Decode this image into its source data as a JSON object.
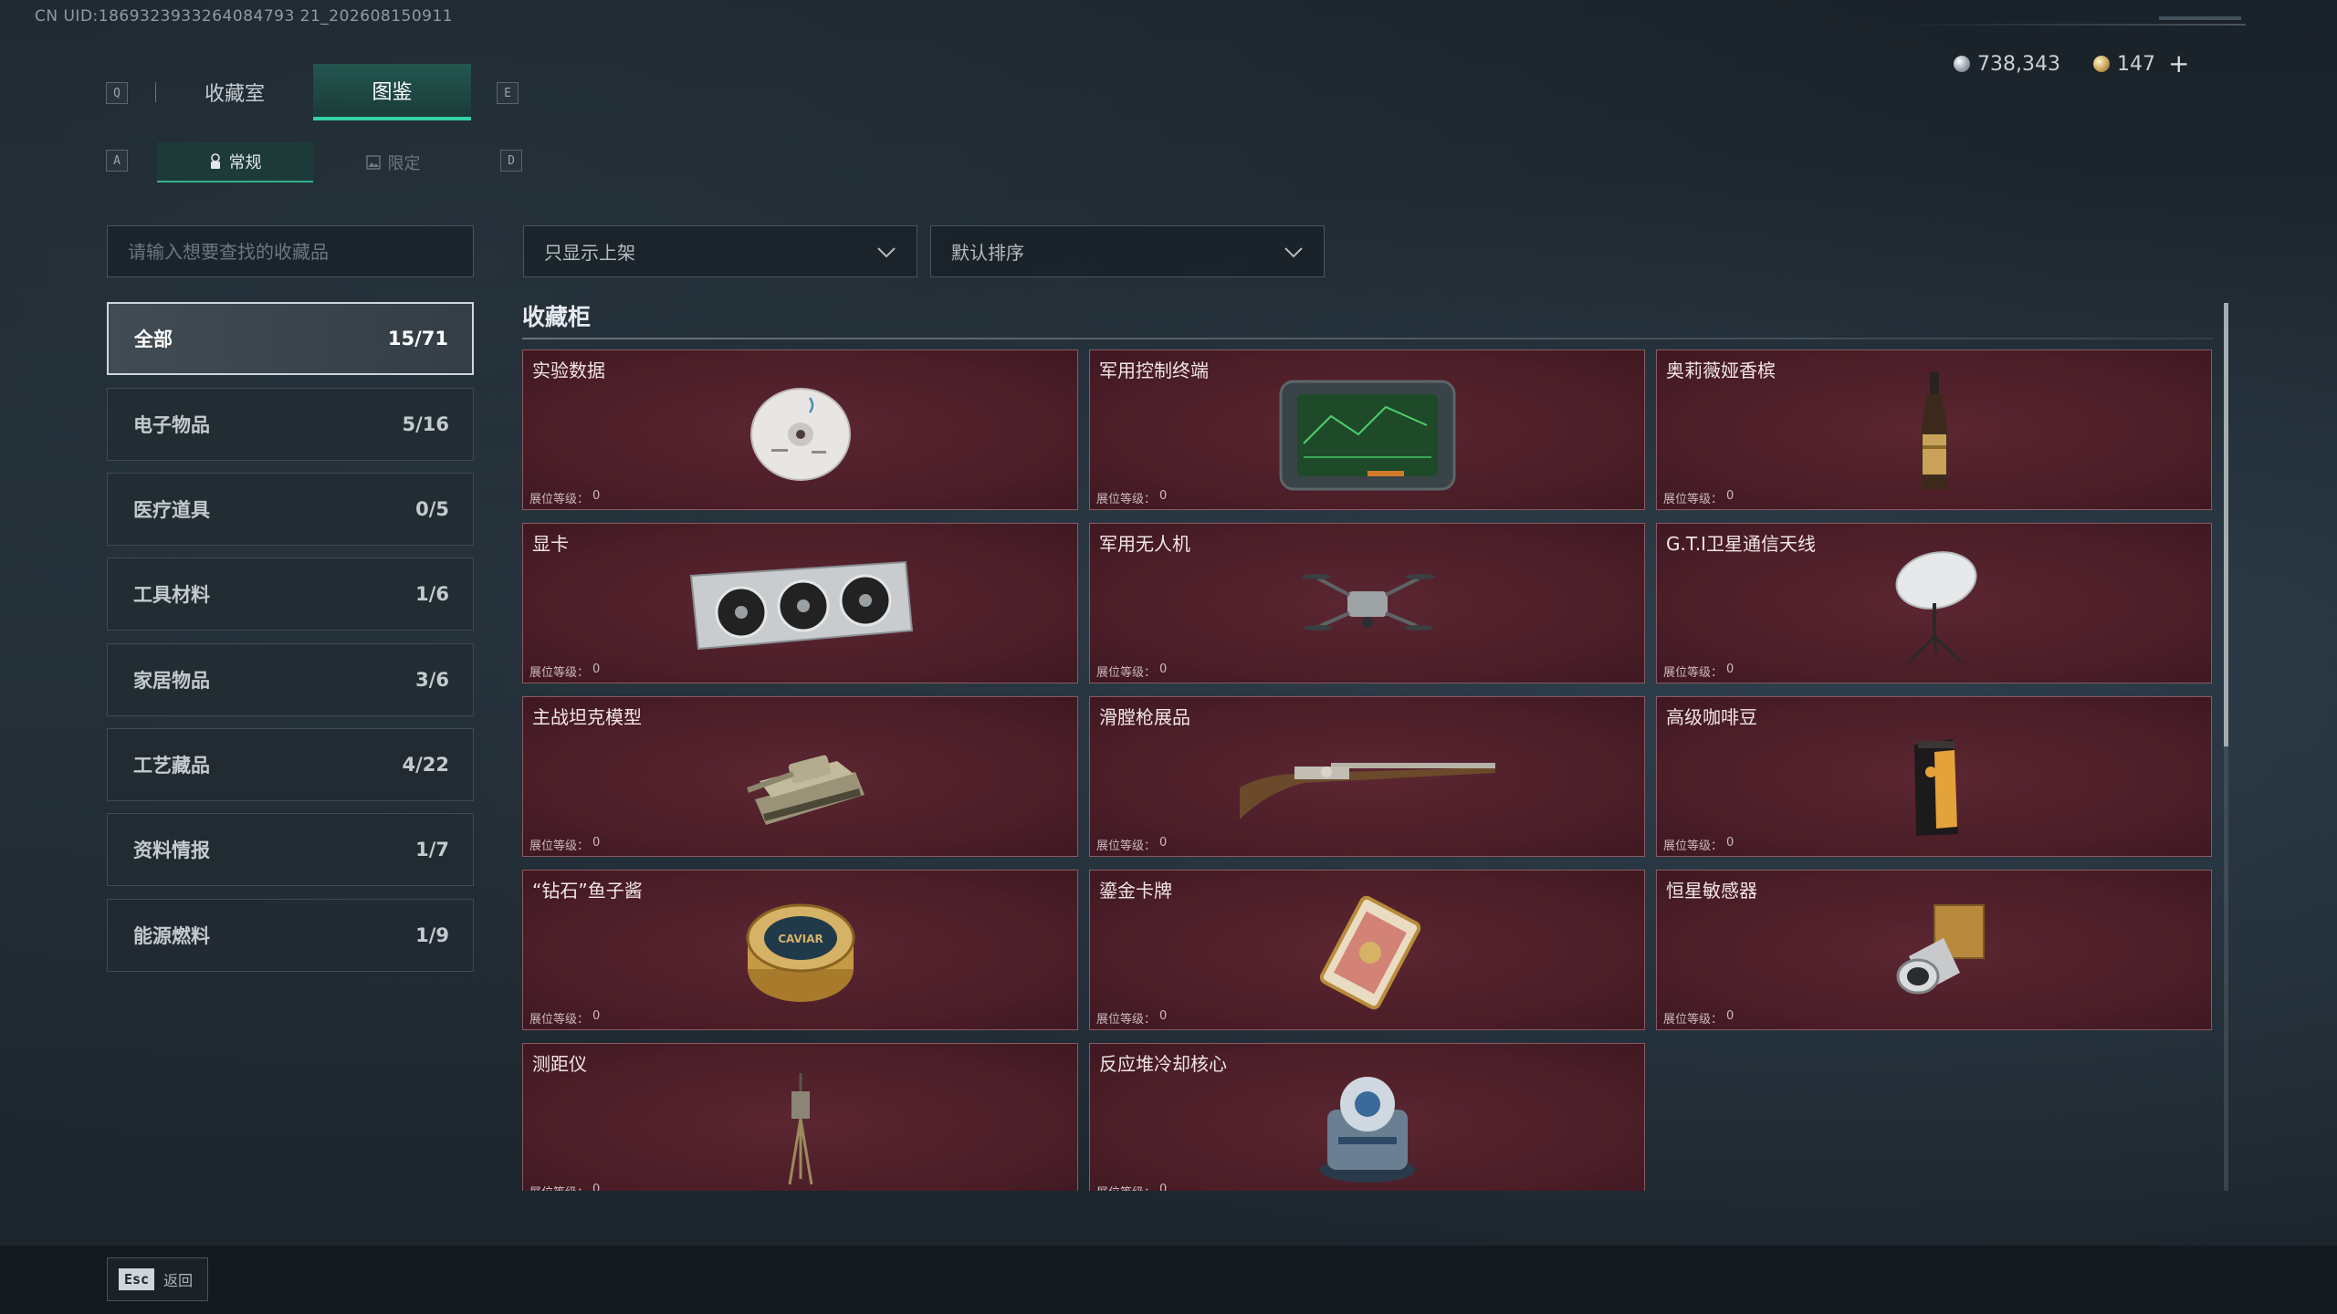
{
  "uid_text": "CN UID:1869323933264084793 21_202608150911",
  "currency": {
    "silver": "738,343",
    "gold": "147",
    "plus": "+"
  },
  "keys": {
    "q": "Q",
    "e": "E",
    "a": "A",
    "d": "D"
  },
  "tabs": [
    {
      "label": "收藏室",
      "active": false
    },
    {
      "label": "图鉴",
      "active": true
    }
  ],
  "subtabs": [
    {
      "label": "常规",
      "icon": "lock-key-icon",
      "active": true
    },
    {
      "label": "限定",
      "icon": "image-icon",
      "active": false
    }
  ],
  "search": {
    "placeholder": "请输入想要查找的收藏品",
    "value": ""
  },
  "filters": {
    "shelf": "只显示上架",
    "sort": "默认排序"
  },
  "categories": [
    {
      "label": "全部",
      "count": "15/71",
      "active": true
    },
    {
      "label": "电子物品",
      "count": "5/16"
    },
    {
      "label": "医疗道具",
      "count": "0/5"
    },
    {
      "label": "工具材料",
      "count": "1/6"
    },
    {
      "label": "家居物品",
      "count": "3/6"
    },
    {
      "label": "工艺藏品",
      "count": "4/22"
    },
    {
      "label": "资料情报",
      "count": "1/7"
    },
    {
      "label": "能源燃料",
      "count": "1/9"
    }
  ],
  "section_title": "收藏柜",
  "level_label": "展位等级：",
  "items": [
    {
      "name": "实验数据",
      "level": "0",
      "icon": "disc-icon"
    },
    {
      "name": "军用控制终端",
      "level": "0",
      "icon": "tablet-terminal-icon"
    },
    {
      "name": "奥莉薇娅香槟",
      "level": "0",
      "icon": "champagne-bottle-icon"
    },
    {
      "name": "显卡",
      "level": "0",
      "icon": "graphics-card-icon"
    },
    {
      "name": "军用无人机",
      "level": "0",
      "icon": "drone-icon"
    },
    {
      "name": "G.T.I卫星通信天线",
      "level": "0",
      "icon": "satellite-dish-icon"
    },
    {
      "name": "主战坦克模型",
      "level": "0",
      "icon": "tank-model-icon"
    },
    {
      "name": "滑膛枪展品",
      "level": "0",
      "icon": "musket-icon"
    },
    {
      "name": "高级咖啡豆",
      "level": "0",
      "icon": "coffee-bag-icon"
    },
    {
      "name": "“钻石”鱼子酱",
      "level": "0",
      "icon": "caviar-tin-icon"
    },
    {
      "name": "鎏金卡牌",
      "level": "0",
      "icon": "gilded-card-icon"
    },
    {
      "name": "恒星敏感器",
      "level": "0",
      "icon": "star-sensor-icon"
    },
    {
      "name": "测距仪",
      "level": "0",
      "icon": "rangefinder-icon"
    },
    {
      "name": "反应堆冷却核心",
      "level": "0",
      "icon": "reactor-core-icon"
    }
  ],
  "caviar_text": "CAVIAR",
  "footer": {
    "esc_key": "Esc",
    "esc_label": "返回"
  }
}
